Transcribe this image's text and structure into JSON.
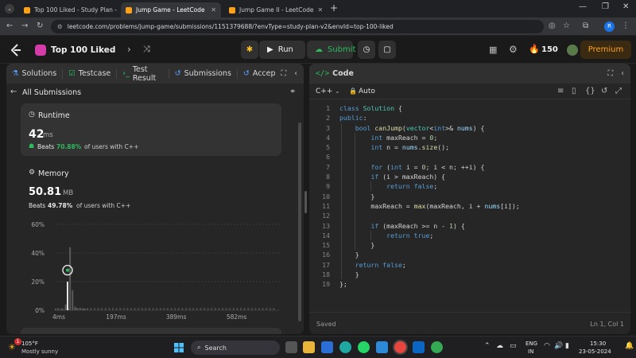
{
  "browser": {
    "tabs": [
      {
        "title": "Top 100 Liked - Study Plan - LeetC",
        "color": "#ffa116",
        "active": false
      },
      {
        "title": "Jump Game - LeetCode",
        "color": "#ffa116",
        "active": true
      },
      {
        "title": "Jump Game II - LeetCode",
        "color": "#ffa116",
        "active": false
      }
    ],
    "url": "leetcode.com/problems/jump-game/submissions/1151379688/?envType=study-plan-v2&envId=top-100-liked",
    "profile_initial": "R"
  },
  "header": {
    "list_title": "Top 100 Liked",
    "run_label": "Run",
    "submit_label": "Submit",
    "streak_count": "150",
    "premium_label": "Premium"
  },
  "left_panel": {
    "tabs": [
      "Solutions",
      "Testcase",
      "Test Result",
      "Submissions",
      "Accep"
    ],
    "back_label": "All Submissions",
    "runtime": {
      "label": "Runtime",
      "value": "42",
      "unit": "ms",
      "beats_prefix": "Beats",
      "beats_pct": "70.88%",
      "beats_suffix": "of users with C++"
    },
    "memory": {
      "label": "Memory",
      "value": "50.81",
      "unit": "MB",
      "beats_prefix": "Beats",
      "beats_pct": "49.78%",
      "beats_suffix": "of users with C++"
    }
  },
  "chart_data": {
    "type": "bar",
    "y_ticks": [
      "60%",
      "40%",
      "20%",
      "0%"
    ],
    "ylim": [
      0,
      60
    ],
    "x_ticks": [
      "4ms",
      "197ms",
      "389ms",
      "582ms"
    ],
    "xlim": [
      4,
      720
    ],
    "highlight_x": 42,
    "bars": [
      {
        "x": 4,
        "value": 1.2
      },
      {
        "x": 12,
        "value": 0.8
      },
      {
        "x": 20,
        "value": 0.6
      },
      {
        "x": 28,
        "value": 0.8
      },
      {
        "x": 36,
        "value": 4
      },
      {
        "x": 42,
        "value": 20
      },
      {
        "x": 50,
        "value": 44
      },
      {
        "x": 58,
        "value": 14
      },
      {
        "x": 66,
        "value": 2.5
      },
      {
        "x": 74,
        "value": 1.5
      },
      {
        "x": 82,
        "value": 1.8
      },
      {
        "x": 90,
        "value": 1.2
      },
      {
        "x": 98,
        "value": 1
      },
      {
        "x": 106,
        "value": 0.8
      }
    ]
  },
  "right_panel": {
    "title": "Code",
    "language": "C++",
    "mode": "Auto",
    "status_left": "Saved",
    "status_right": "Ln 1, Col 1",
    "code_lines": [
      "class Solution {",
      "public:",
      "    bool canJump(vector<int>& nums) {",
      "        int maxReach = 0;",
      "        int n = nums.size();",
      "",
      "        for (int i = 0; i < n; ++i) {",
      "        if (i > maxReach) {",
      "            return false;",
      "        }",
      "        maxReach = max(maxReach, i + nums[i]);",
      "",
      "        if (maxReach >= n - 1) {",
      "            return true;",
      "        }",
      "    }",
      "    return false;",
      "    }",
      "};"
    ]
  },
  "taskbar": {
    "weather_temp": "105°F",
    "weather_desc": "Mostly sunny",
    "search_label": "Search",
    "lang": "ENG",
    "region": "IN",
    "time": "15:30",
    "date": "23-05-2024",
    "notif_badge": "1"
  }
}
